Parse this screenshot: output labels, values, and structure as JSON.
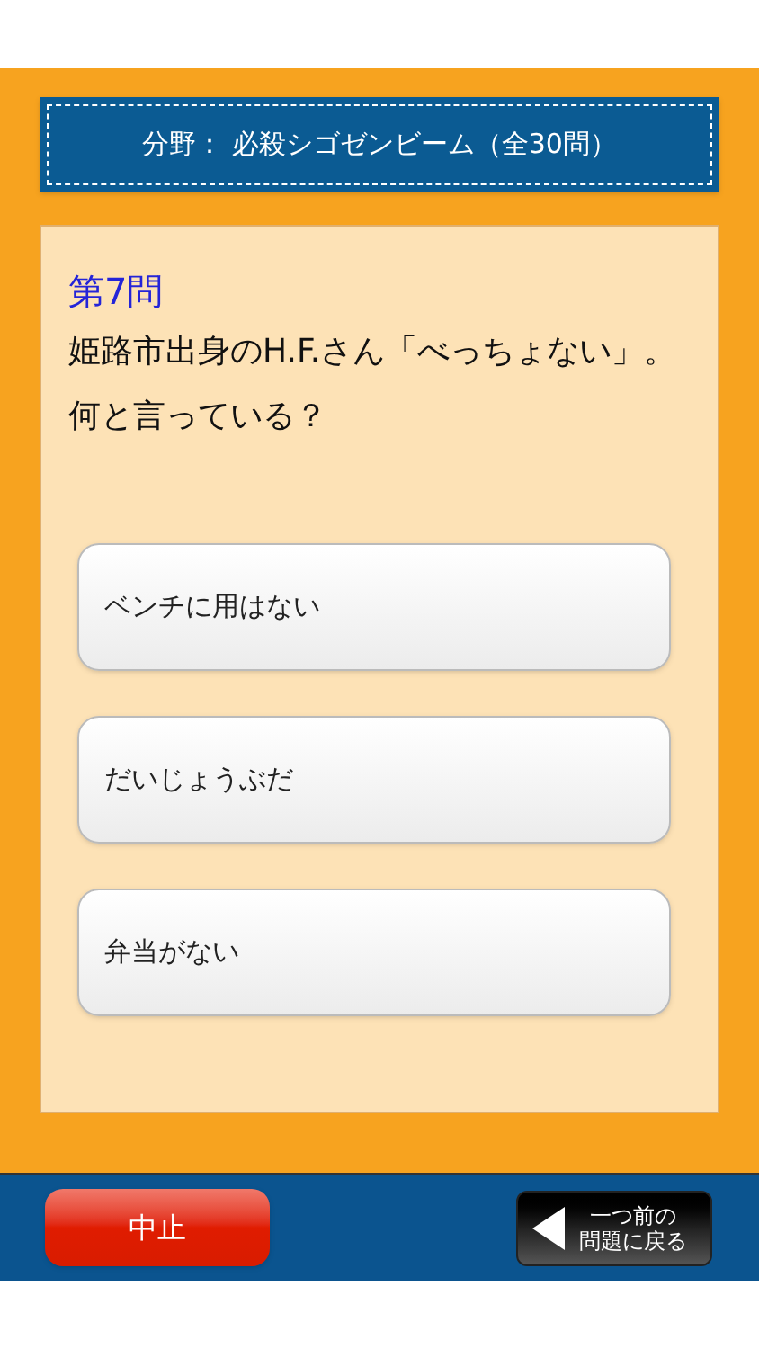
{
  "header": {
    "title": "分野： 必殺シゴゼンビーム（全30問）"
  },
  "question": {
    "number": "第7問",
    "text": "姫路市出身のH.F.さん「べっちょない」。何と言っている？"
  },
  "answers": [
    {
      "label": "ベンチに用はない"
    },
    {
      "label": "だいじょうぶだ"
    },
    {
      "label": "弁当がない"
    }
  ],
  "footer": {
    "quit": "中止",
    "back_lines": [
      "一つ前の",
      "問題に戻る"
    ]
  }
}
